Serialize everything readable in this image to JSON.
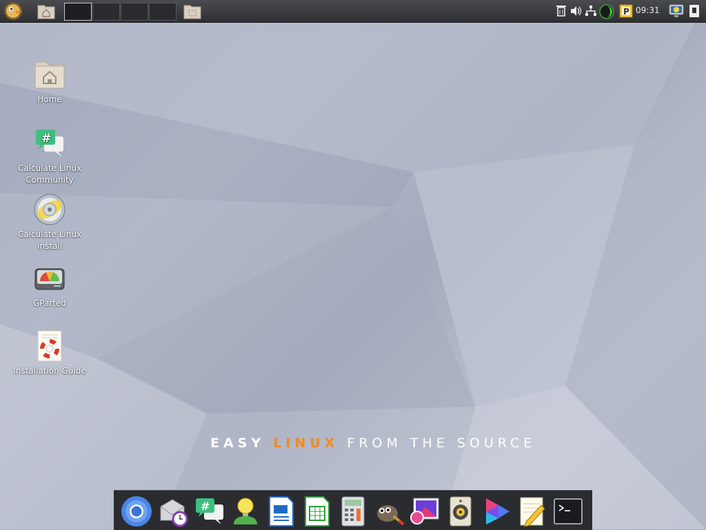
{
  "desktop": {
    "icons": [
      {
        "label": "Home",
        "icon": "home-folder-icon"
      },
      {
        "label": "Calculate Linux Community",
        "icon": "community-chat-icon"
      },
      {
        "label": "Calculate Linux Install",
        "icon": "install-disc-icon"
      },
      {
        "label": "GParted",
        "icon": "gparted-disk-icon"
      },
      {
        "label": "Installation Guide",
        "icon": "lifebuoy-guide-icon"
      }
    ],
    "slogan": {
      "word1": "EASY",
      "word2": "LINUX",
      "word3": "FROM THE SOURCE"
    }
  },
  "top_panel": {
    "menu_icon": "calculate-menu-icon",
    "workspaces_count": 4,
    "active_workspace": 1,
    "clock": "09:31",
    "tray_icons": [
      "trash-icon",
      "volume-icon",
      "network-icon",
      "update-indicator-icon",
      "keyboard-layout-icon",
      "screenshot-icon",
      "power-icon"
    ]
  },
  "dock": {
    "items": [
      {
        "name": "chromium",
        "icon": "chromium-icon"
      },
      {
        "name": "mail-scheduler",
        "icon": "mail-clock-icon"
      },
      {
        "name": "community-chat",
        "icon": "community-chat-icon"
      },
      {
        "name": "user-agent",
        "icon": "user-idea-icon"
      },
      {
        "name": "writer",
        "icon": "writer-icon"
      },
      {
        "name": "calc",
        "icon": "spreadsheet-icon"
      },
      {
        "name": "calculator",
        "icon": "calculator-icon"
      },
      {
        "name": "gimp",
        "icon": "gimp-icon"
      },
      {
        "name": "image-viewer",
        "icon": "image-viewer-icon"
      },
      {
        "name": "music-player",
        "icon": "speaker-icon"
      },
      {
        "name": "video-player",
        "icon": "video-player-icon"
      },
      {
        "name": "text-editor",
        "icon": "text-editor-icon"
      },
      {
        "name": "terminal",
        "icon": "terminal-icon"
      }
    ]
  },
  "colors": {
    "accent": "#f08a1c",
    "panel": "#2e2f32"
  }
}
